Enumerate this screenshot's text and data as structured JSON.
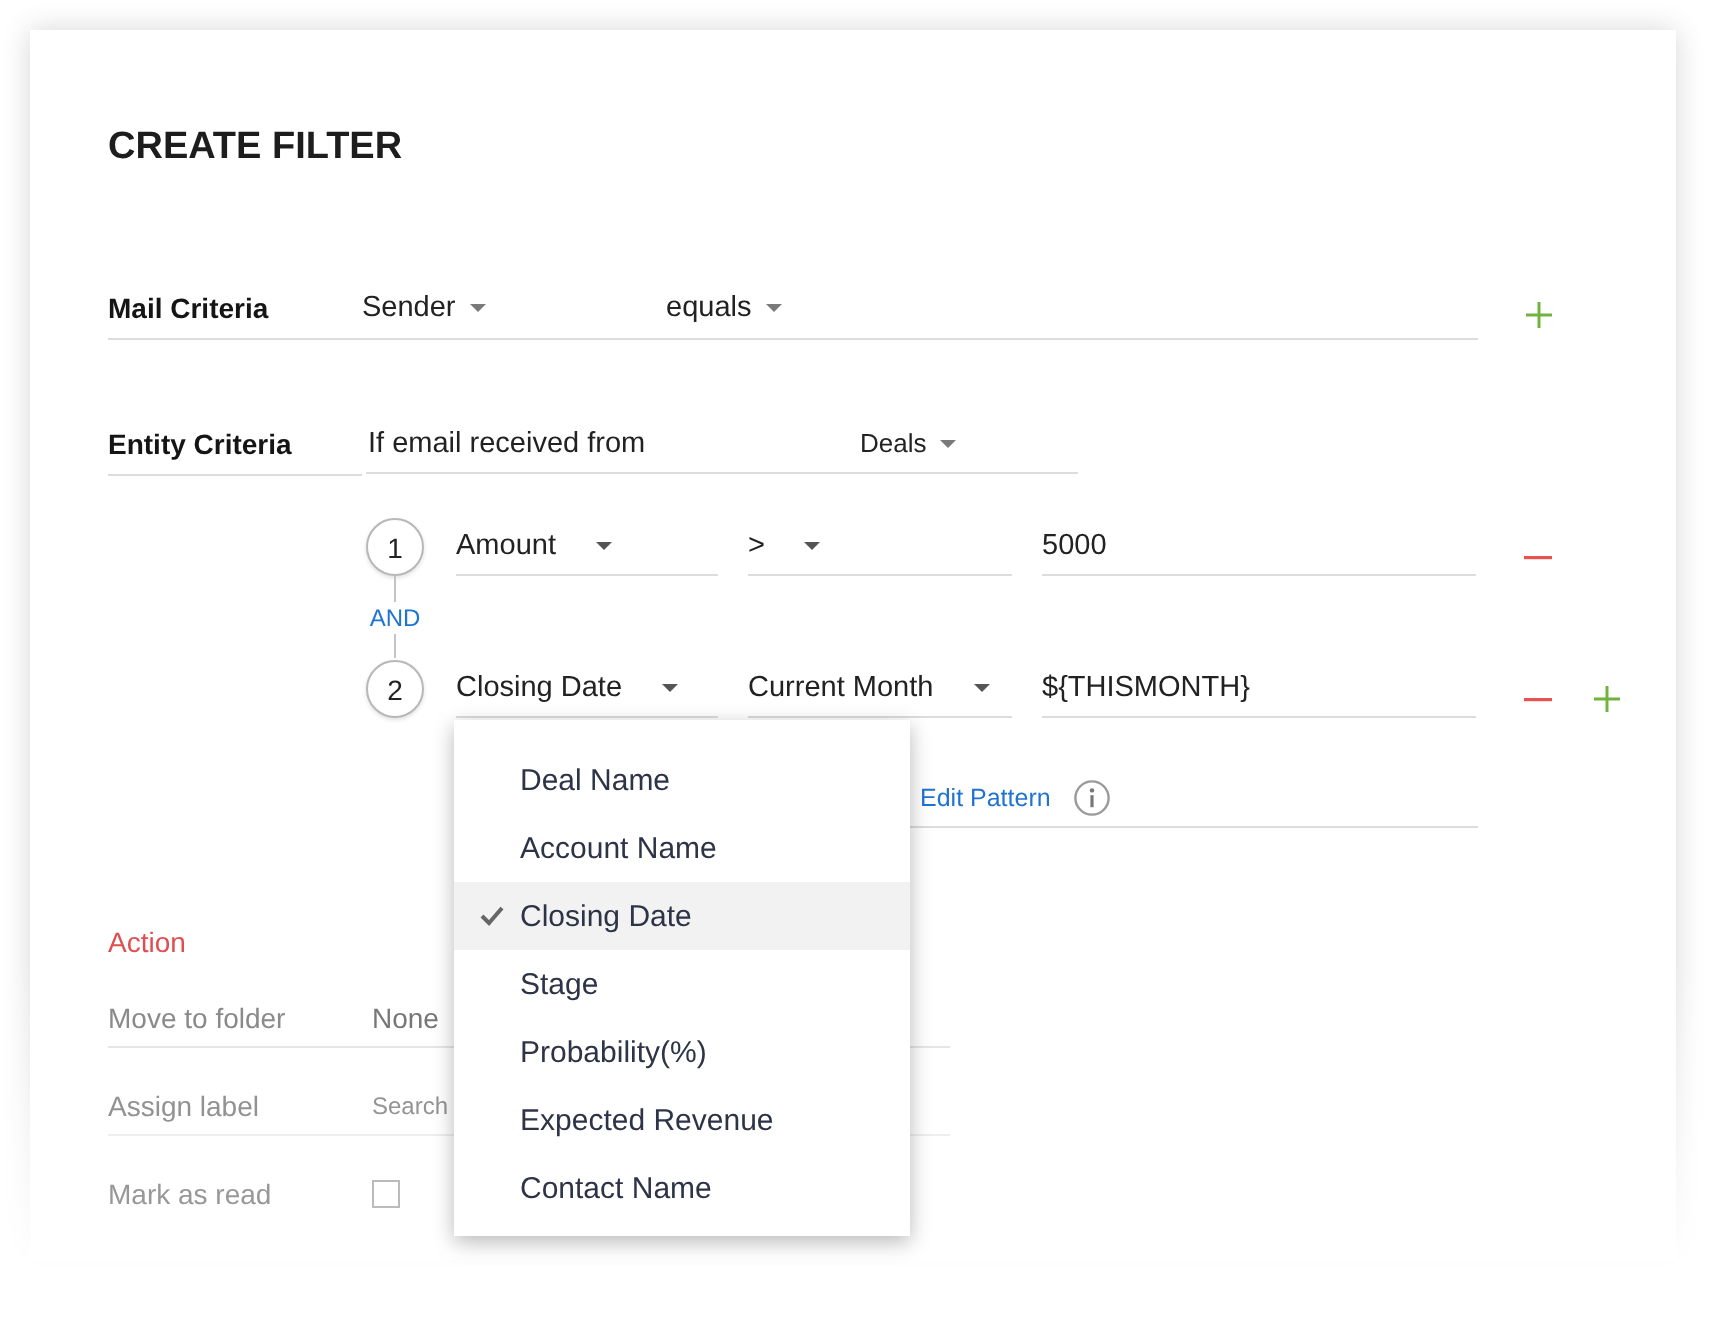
{
  "title": "CREATE FILTER",
  "mail_criteria": {
    "label": "Mail Criteria",
    "field": "Sender",
    "operator": "equals"
  },
  "entity_criteria": {
    "label": "Entity Criteria",
    "condition": "If email received from",
    "module": "Deals"
  },
  "conditions": [
    {
      "number": "1",
      "field": "Amount",
      "operator": ">",
      "value": "5000"
    },
    {
      "number": "2",
      "field": "Closing Date",
      "operator": "Current Month",
      "value": "${THISMONTH}"
    }
  ],
  "connector": "AND",
  "pattern": {
    "link": "Edit Pattern"
  },
  "field_menu": {
    "items": [
      {
        "label": "Deal Name",
        "selected": false
      },
      {
        "label": "Account Name",
        "selected": false
      },
      {
        "label": "Closing Date",
        "selected": true
      },
      {
        "label": "Stage",
        "selected": false
      },
      {
        "label": "Probability(%)",
        "selected": false
      },
      {
        "label": "Expected Revenue",
        "selected": false
      },
      {
        "label": "Contact Name",
        "selected": false
      }
    ]
  },
  "action": {
    "heading": "Action",
    "rows": [
      {
        "kind": "select",
        "label": "Move to folder",
        "value": "None"
      },
      {
        "kind": "search",
        "label": "Assign label",
        "placeholder": "Search"
      },
      {
        "kind": "checkbox",
        "label": "Mark as read",
        "checked": false
      }
    ]
  }
}
